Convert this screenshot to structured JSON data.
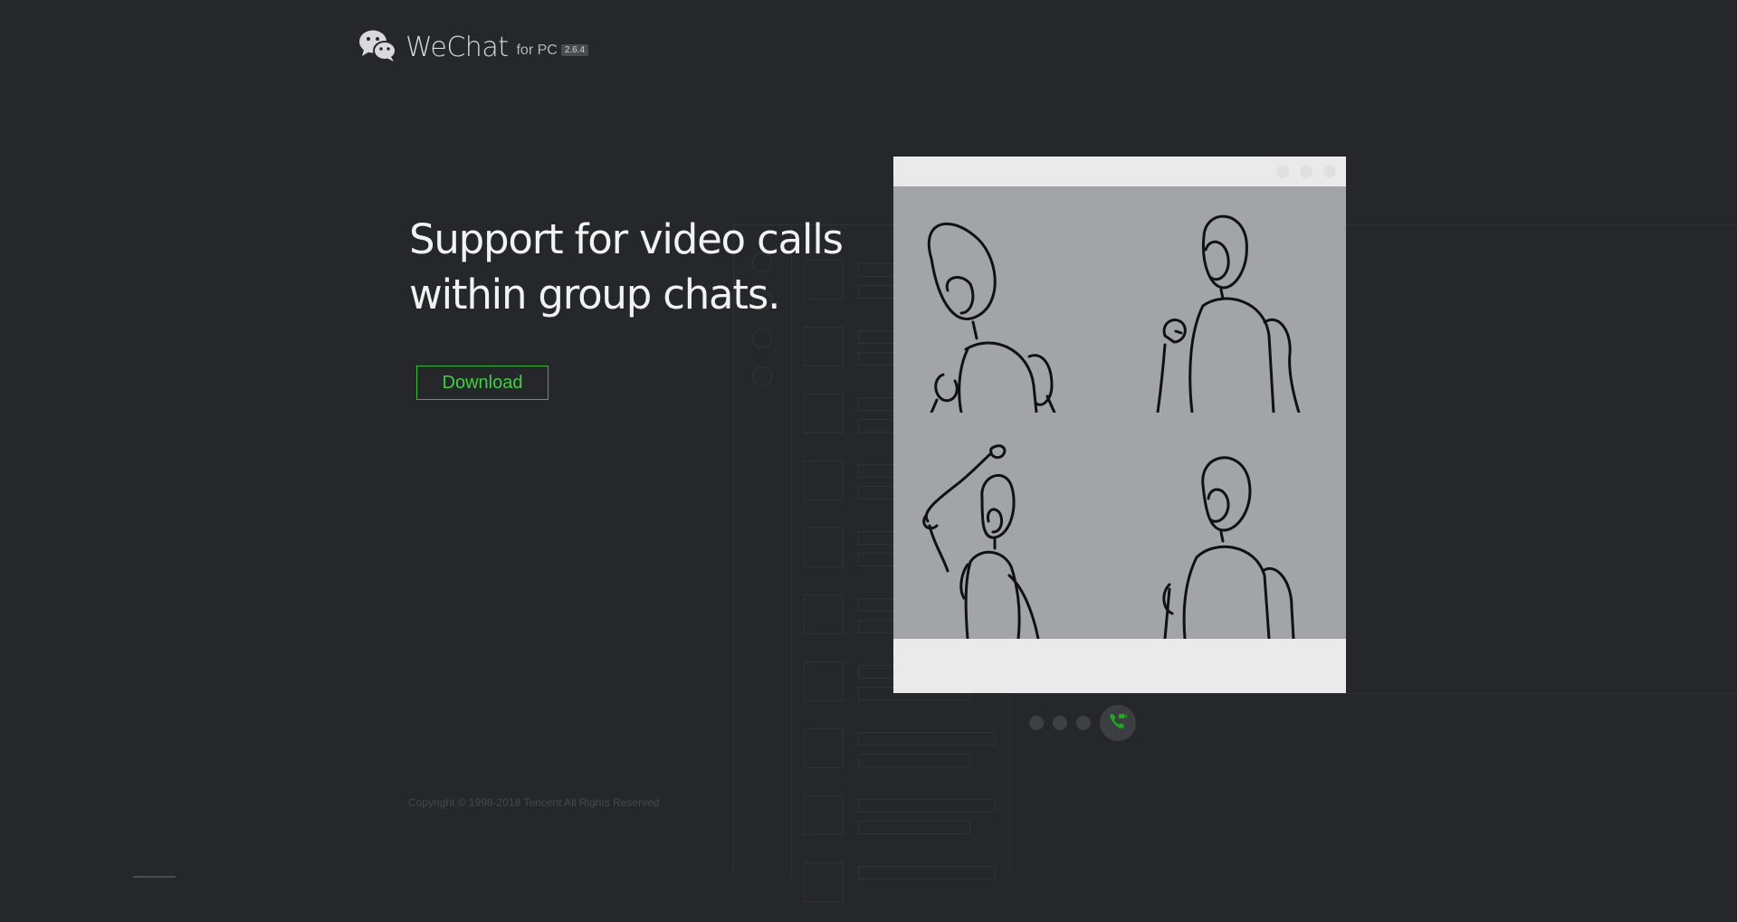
{
  "header": {
    "app_name": "WeChat",
    "subtitle": "for PC",
    "version": "2.6.4",
    "logo_icon": "wechat-logo-icon"
  },
  "hero": {
    "headline_line1": "Support for video calls",
    "headline_line2": "within group chats.",
    "download_label": "Download"
  },
  "footer": {
    "copyright": "Copyright © 1998-2018 Tencent All Rights Reserved"
  },
  "video_call": {
    "participant_count": 4,
    "call_icon": "video-call-icon",
    "window_controls": [
      "minimize-icon",
      "maximize-icon",
      "close-icon"
    ]
  },
  "colors": {
    "background": "#26272b",
    "accent_green": "#2dbe2d",
    "call_icon_green": "#1aad19",
    "tile_background": "#a2a4a8"
  }
}
